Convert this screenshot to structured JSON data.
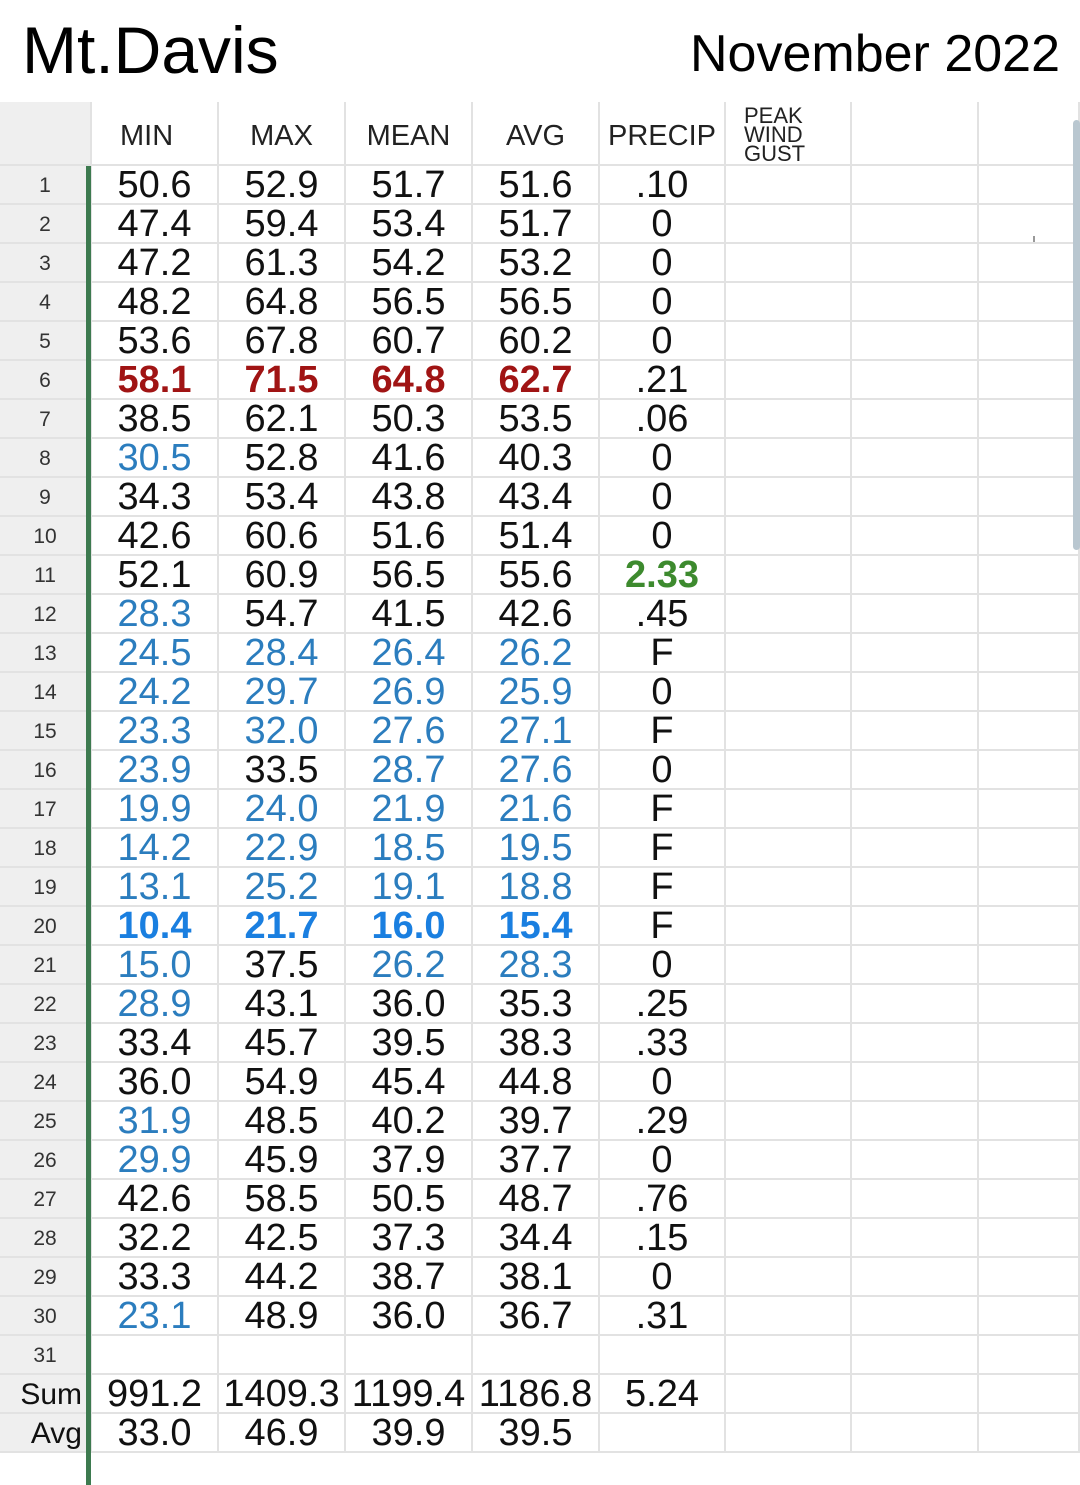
{
  "title": {
    "station": "Mt.Davis",
    "month": "November 2022"
  },
  "colors": {
    "normal": "#111111",
    "cold": "#2b7dbe",
    "record_high": "#a01414",
    "record_low": "#1a7fe0",
    "max_precip": "#3d8a2e",
    "grid": "#e2e2e2",
    "row_header_bg": "#efefef",
    "freeze_line": "#3d7a4f"
  },
  "header": {
    "columns": [
      "MIN",
      "MAX",
      "MEAN",
      "AVG",
      "PRECIP"
    ],
    "peak_wind_gust": [
      "PEAK",
      "WIND",
      "GUST"
    ]
  },
  "rows": [
    {
      "day": "1",
      "min": "50.6",
      "max": "52.9",
      "mean": "51.7",
      "avg": "51.6",
      "precip": ".10"
    },
    {
      "day": "2",
      "min": "47.4",
      "max": "59.4",
      "mean": "53.4",
      "avg": "51.7",
      "precip": "0"
    },
    {
      "day": "3",
      "min": "47.2",
      "max": "61.3",
      "mean": "54.2",
      "avg": "53.2",
      "precip": "0"
    },
    {
      "day": "4",
      "min": "48.2",
      "max": "64.8",
      "mean": "56.5",
      "avg": "56.5",
      "precip": "0"
    },
    {
      "day": "5",
      "min": "53.6",
      "max": "67.8",
      "mean": "60.7",
      "avg": "60.2",
      "precip": "0"
    },
    {
      "day": "6",
      "min": "58.1",
      "max": "71.5",
      "mean": "64.8",
      "avg": "62.7",
      "precip": ".21"
    },
    {
      "day": "7",
      "min": "38.5",
      "max": "62.1",
      "mean": "50.3",
      "avg": "53.5",
      "precip": ".06"
    },
    {
      "day": "8",
      "min": "30.5",
      "max": "52.8",
      "mean": "41.6",
      "avg": "40.3",
      "precip": "0"
    },
    {
      "day": "9",
      "min": "34.3",
      "max": "53.4",
      "mean": "43.8",
      "avg": "43.4",
      "precip": "0"
    },
    {
      "day": "10",
      "min": "42.6",
      "max": "60.6",
      "mean": "51.6",
      "avg": "51.4",
      "precip": "0"
    },
    {
      "day": "11",
      "min": "52.1",
      "max": "60.9",
      "mean": "56.5",
      "avg": "55.6",
      "precip": "2.33"
    },
    {
      "day": "12",
      "min": "28.3",
      "max": "54.7",
      "mean": "41.5",
      "avg": "42.6",
      "precip": ".45"
    },
    {
      "day": "13",
      "min": "24.5",
      "max": "28.4",
      "mean": "26.4",
      "avg": "26.2",
      "precip": "F"
    },
    {
      "day": "14",
      "min": "24.2",
      "max": "29.7",
      "mean": "26.9",
      "avg": "25.9",
      "precip": "0"
    },
    {
      "day": "15",
      "min": "23.3",
      "max": "32.0",
      "mean": "27.6",
      "avg": "27.1",
      "precip": "F"
    },
    {
      "day": "16",
      "min": "23.9",
      "max": "33.5",
      "mean": "28.7",
      "avg": "27.6",
      "precip": "0"
    },
    {
      "day": "17",
      "min": "19.9",
      "max": "24.0",
      "mean": "21.9",
      "avg": "21.6",
      "precip": "F"
    },
    {
      "day": "18",
      "min": "14.2",
      "max": "22.9",
      "mean": "18.5",
      "avg": "19.5",
      "precip": "F"
    },
    {
      "day": "19",
      "min": "13.1",
      "max": "25.2",
      "mean": "19.1",
      "avg": "18.8",
      "precip": "F"
    },
    {
      "day": "20",
      "min": "10.4",
      "max": "21.7",
      "mean": "16.0",
      "avg": "15.4",
      "precip": "F"
    },
    {
      "day": "21",
      "min": "15.0",
      "max": "37.5",
      "mean": "26.2",
      "avg": "28.3",
      "precip": "0"
    },
    {
      "day": "22",
      "min": "28.9",
      "max": "43.1",
      "mean": "36.0",
      "avg": "35.3",
      "precip": ".25"
    },
    {
      "day": "23",
      "min": "33.4",
      "max": "45.7",
      "mean": "39.5",
      "avg": "38.3",
      "precip": ".33"
    },
    {
      "day": "24",
      "min": "36.0",
      "max": "54.9",
      "mean": "45.4",
      "avg": "44.8",
      "precip": "0"
    },
    {
      "day": "25",
      "min": "31.9",
      "max": "48.5",
      "mean": "40.2",
      "avg": "39.7",
      "precip": ".29"
    },
    {
      "day": "26",
      "min": "29.9",
      "max": "45.9",
      "mean": "37.9",
      "avg": "37.7",
      "precip": "0"
    },
    {
      "day": "27",
      "min": "42.6",
      "max": "58.5",
      "mean": "50.5",
      "avg": "48.7",
      "precip": ".76"
    },
    {
      "day": "28",
      "min": "32.2",
      "max": "42.5",
      "mean": "37.3",
      "avg": "34.4",
      "precip": ".15"
    },
    {
      "day": "29",
      "min": "33.3",
      "max": "44.2",
      "mean": "38.7",
      "avg": "38.1",
      "precip": "0"
    },
    {
      "day": "30",
      "min": "23.1",
      "max": "48.9",
      "mean": "36.0",
      "avg": "36.7",
      "precip": ".31"
    },
    {
      "day": "31",
      "min": "",
      "max": "",
      "mean": "",
      "avg": "",
      "precip": ""
    }
  ],
  "sum": {
    "label": "Sum",
    "min": "991.2",
    "max": "1409.3",
    "mean": "1199.4",
    "avg": "1186.8",
    "precip": "5.24"
  },
  "avg": {
    "label": "Avg",
    "min": "33.0",
    "max": "46.9",
    "mean": "39.9",
    "avg": "39.5",
    "precip": ""
  }
}
